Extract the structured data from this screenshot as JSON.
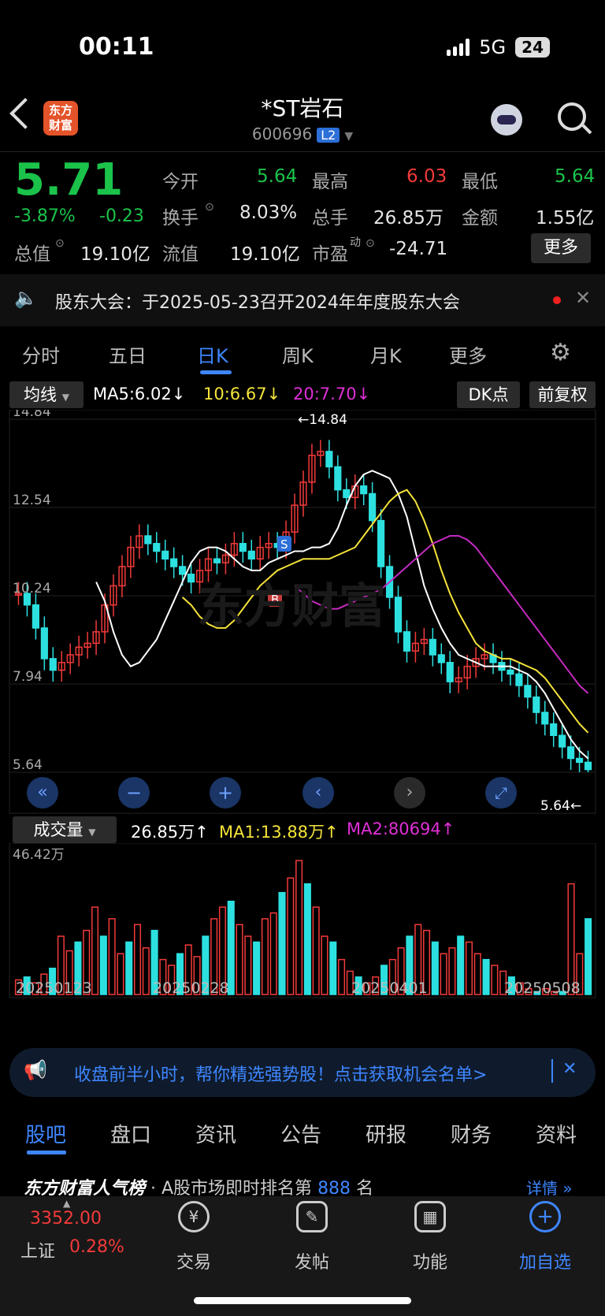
{
  "status_bar": {
    "time": "00:11",
    "network": "5G",
    "battery": "24"
  },
  "header": {
    "logo": "东方财富",
    "title": "*ST岩石",
    "code": "600696",
    "level": "L2"
  },
  "quote": {
    "price": "5.71",
    "change_pct": "-3.87%",
    "change": "-0.23",
    "open_label": "今开",
    "open": "5.64",
    "high_label": "最高",
    "high": "6.03",
    "low_label": "最低",
    "low": "5.64",
    "turnover_label": "换手",
    "turnover": "8.03%",
    "volume_label": "总手",
    "volume": "26.85万",
    "amount_label": "金额",
    "amount": "1.55亿",
    "mktcap_label": "总值",
    "mktcap": "19.10亿",
    "float_label": "流值",
    "float": "19.10亿",
    "pe_label": "市盈",
    "pe_sup": "动",
    "pe": "-24.71",
    "more": "更多"
  },
  "notice": {
    "text": "股东大会：于2025-05-23召开2024年年度股东大会"
  },
  "tabs": [
    "分时",
    "五日",
    "日K",
    "周K",
    "月K",
    "更多"
  ],
  "chart_controls": {
    "ma_select": "均线",
    "ma5": "MA5:6.02",
    "ma10": "10:6.67",
    "ma20": "20:7.70",
    "dk_button": "DK点",
    "adjust_button": "前复权",
    "vol_select": "成交量",
    "vol_value": "26.85万",
    "vol_ma1": "MA1:13.88万",
    "vol_ma2": "MA2:80694"
  },
  "chart_data": {
    "type": "candlestick",
    "y_ticks": [
      "14.84",
      "12.54",
      "10.24",
      "7.94",
      "5.64"
    ],
    "high_marker": "14.84",
    "low_marker": "5.64",
    "vol_max_label": "46.42万",
    "x_dates": [
      "20250123",
      "20250228",
      "20250401",
      "20250508"
    ],
    "ylim": [
      5.64,
      14.84
    ],
    "closes": [
      10.3,
      10.0,
      9.4,
      8.6,
      8.3,
      8.5,
      8.7,
      8.9,
      9.0,
      9.3,
      10.0,
      10.5,
      11.0,
      11.5,
      11.8,
      11.6,
      11.4,
      11.2,
      11.0,
      10.8,
      10.6,
      10.9,
      11.2,
      11.1,
      11.3,
      11.6,
      11.4,
      11.2,
      11.5,
      11.6,
      11.5,
      11.9,
      12.6,
      13.2,
      13.9,
      14.0,
      13.6,
      13.0,
      12.8,
      13.1,
      12.9,
      12.2,
      11.0,
      10.2,
      9.3,
      8.8,
      9.0,
      9.1,
      8.7,
      8.5,
      8.0,
      8.1,
      8.4,
      8.6,
      8.7,
      8.5,
      8.3,
      8.2,
      7.9,
      7.6,
      7.2,
      6.9,
      6.6,
      6.3,
      6.0,
      5.9,
      5.71
    ],
    "ma5": [
      10.6,
      10.1,
      9.3,
      8.7,
      8.4,
      8.5,
      8.8,
      9.1,
      9.6,
      10.1,
      10.6,
      11.1,
      11.4,
      11.5,
      11.5,
      11.4,
      11.2,
      11.0,
      10.9,
      10.9,
      11.1,
      11.2,
      11.3,
      11.4,
      11.4,
      11.5,
      11.5,
      11.6,
      12.0,
      12.6,
      13.1,
      13.4,
      13.5,
      13.4,
      13.3,
      12.9,
      12.3,
      11.4,
      10.5,
      9.9,
      9.4,
      9.0,
      8.7,
      8.6,
      8.5,
      8.4,
      8.4,
      8.4,
      8.4,
      8.3,
      8.2,
      8.0,
      7.7,
      7.3,
      6.9,
      6.5,
      6.2,
      6.0
    ],
    "ma10": [
      10.2,
      10.0,
      9.7,
      9.5,
      9.4,
      9.4,
      9.6,
      9.9,
      10.2,
      10.5,
      10.7,
      10.9,
      11.0,
      11.1,
      11.2,
      11.2,
      11.2,
      11.2,
      11.3,
      11.4,
      11.5,
      11.8,
      12.1,
      12.4,
      12.7,
      12.9,
      13.0,
      12.7,
      12.2,
      11.6,
      10.9,
      10.3,
      9.8,
      9.4,
      9.0,
      8.8,
      8.7,
      8.6,
      8.6,
      8.5,
      8.4,
      8.3,
      8.1,
      7.8,
      7.5,
      7.2,
      6.9,
      6.67
    ],
    "ma20": [
      10.5,
      10.3,
      10.1,
      10.0,
      9.9,
      9.9,
      10.0,
      10.1,
      10.2,
      10.3,
      10.4,
      10.6,
      10.8,
      11.0,
      11.2,
      11.4,
      11.6,
      11.7,
      11.8,
      11.8,
      11.7,
      11.5,
      11.2,
      10.9,
      10.6,
      10.3,
      10.0,
      9.7,
      9.4,
      9.1,
      8.8,
      8.5,
      8.2,
      7.9,
      7.7
    ],
    "volumes": [
      5,
      6,
      4,
      7,
      9,
      20,
      15,
      18,
      22,
      30,
      20,
      26,
      14,
      18,
      24,
      16,
      22,
      12,
      10,
      14,
      17,
      13,
      20,
      26,
      30,
      32,
      24,
      20,
      18,
      26,
      28,
      35,
      40,
      46,
      38,
      30,
      20,
      18,
      12,
      8,
      6,
      4,
      6,
      10,
      12,
      16,
      20,
      24,
      22,
      18,
      14,
      16,
      20,
      18,
      14,
      12,
      10,
      8,
      6,
      4,
      2,
      1,
      2,
      1,
      1,
      38,
      14,
      26
    ]
  },
  "pager_buttons": [
    "first",
    "zoom-out",
    "zoom-in",
    "prev",
    "next",
    "fullscreen"
  ],
  "banner": {
    "text": "收盘前半小时，帮你精选强势股！点击获取机会名单>"
  },
  "sub_tabs": [
    "股吧",
    "盘口",
    "资讯",
    "公告",
    "研报",
    "财务",
    "资料"
  ],
  "rank": {
    "title": "东方财富人气榜",
    "text": "· A股市场即时排名第",
    "value": "888",
    "unit": "名",
    "detail": "详情"
  },
  "dock": {
    "index_value": "3352.00",
    "index_name": "上证",
    "index_change": "0.28%",
    "items": [
      "交易",
      "发帖",
      "功能",
      "加自选"
    ]
  }
}
